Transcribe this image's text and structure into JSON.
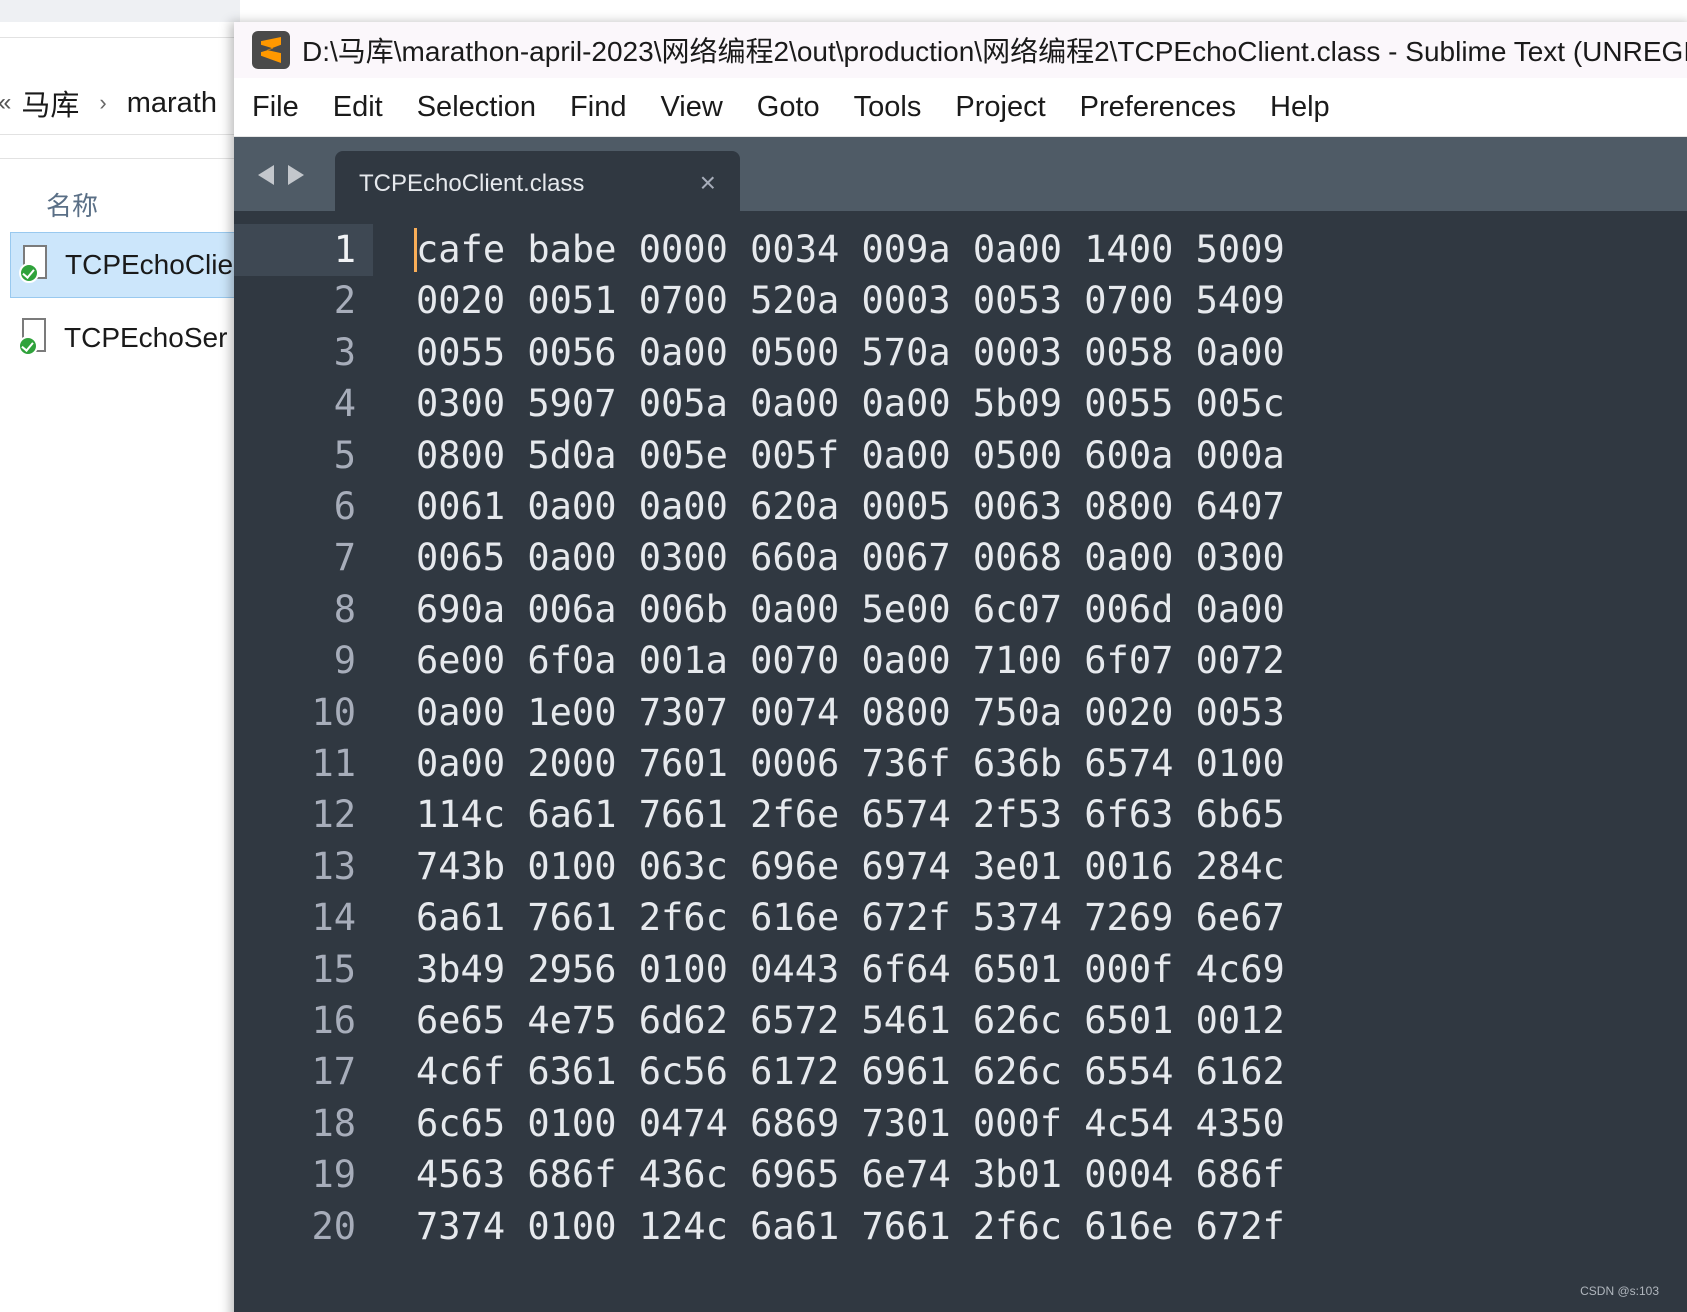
{
  "explorer": {
    "breadcrumb": {
      "lead": "«",
      "items": [
        "马库",
        "marath"
      ],
      "separator": "›"
    },
    "column_header": "名称",
    "files": [
      {
        "name": "TCPEchoClie",
        "selected": true,
        "icon": "java-class-file-icon"
      },
      {
        "name": "TCPEchoSer",
        "selected": false,
        "icon": "java-class-file-icon"
      }
    ]
  },
  "window": {
    "title": "D:\\马库\\marathon-april-2023\\网络编程2\\out\\production\\网络编程2\\TCPEchoClient.class - Sublime Text (UNREGISTERED)",
    "app_icon": "sublime-text-logo-icon"
  },
  "menu": [
    "File",
    "Edit",
    "Selection",
    "Find",
    "View",
    "Goto",
    "Tools",
    "Project",
    "Preferences",
    "Help"
  ],
  "tab": {
    "label": "TCPEchoClient.class",
    "close": "×"
  },
  "editor": {
    "active_line": 1,
    "lines": [
      {
        "n": "1",
        "text": "cafe babe 0000 0034 009a 0a00 1400 5009"
      },
      {
        "n": "2",
        "text": "0020 0051 0700 520a 0003 0053 0700 5409"
      },
      {
        "n": "3",
        "text": "0055 0056 0a00 0500 570a 0003 0058 0a00"
      },
      {
        "n": "4",
        "text": "0300 5907 005a 0a00 0a00 5b09 0055 005c"
      },
      {
        "n": "5",
        "text": "0800 5d0a 005e 005f 0a00 0500 600a 000a"
      },
      {
        "n": "6",
        "text": "0061 0a00 0a00 620a 0005 0063 0800 6407"
      },
      {
        "n": "7",
        "text": "0065 0a00 0300 660a 0067 0068 0a00 0300"
      },
      {
        "n": "8",
        "text": "690a 006a 006b 0a00 5e00 6c07 006d 0a00"
      },
      {
        "n": "9",
        "text": "6e00 6f0a 001a 0070 0a00 7100 6f07 0072"
      },
      {
        "n": "10",
        "text": "0a00 1e00 7307 0074 0800 750a 0020 0053"
      },
      {
        "n": "11",
        "text": "0a00 2000 7601 0006 736f 636b 6574 0100"
      },
      {
        "n": "12",
        "text": "114c 6a61 7661 2f6e 6574 2f53 6f63 6b65"
      },
      {
        "n": "13",
        "text": "743b 0100 063c 696e 6974 3e01 0016 284c"
      },
      {
        "n": "14",
        "text": "6a61 7661 2f6c 616e 672f 5374 7269 6e67"
      },
      {
        "n": "15",
        "text": "3b49 2956 0100 0443 6f64 6501 000f 4c69"
      },
      {
        "n": "16",
        "text": "6e65 4e75 6d62 6572 5461 626c 6501 0012"
      },
      {
        "n": "17",
        "text": "4c6f 6361 6c56 6172 6961 626c 6554 6162"
      },
      {
        "n": "18",
        "text": "6c65 0100 0474 6869 7301 000f 4c54 4350"
      },
      {
        "n": "19",
        "text": "4563 686f 436c 6965 6e74 3b01 0004 686f"
      },
      {
        "n": "20",
        "text": "7374 0100 124c 6a61 7661 2f6c 616e 672f"
      }
    ]
  },
  "watermark": "CSDN @s:103",
  "colors": {
    "editor_bg": "#303841",
    "tabbar_bg": "#4f5b66",
    "text": "#e6e9ed",
    "line_number": "#a7adba",
    "cursor": "#f9ae58",
    "explorer_selection": "#cce6fb"
  }
}
